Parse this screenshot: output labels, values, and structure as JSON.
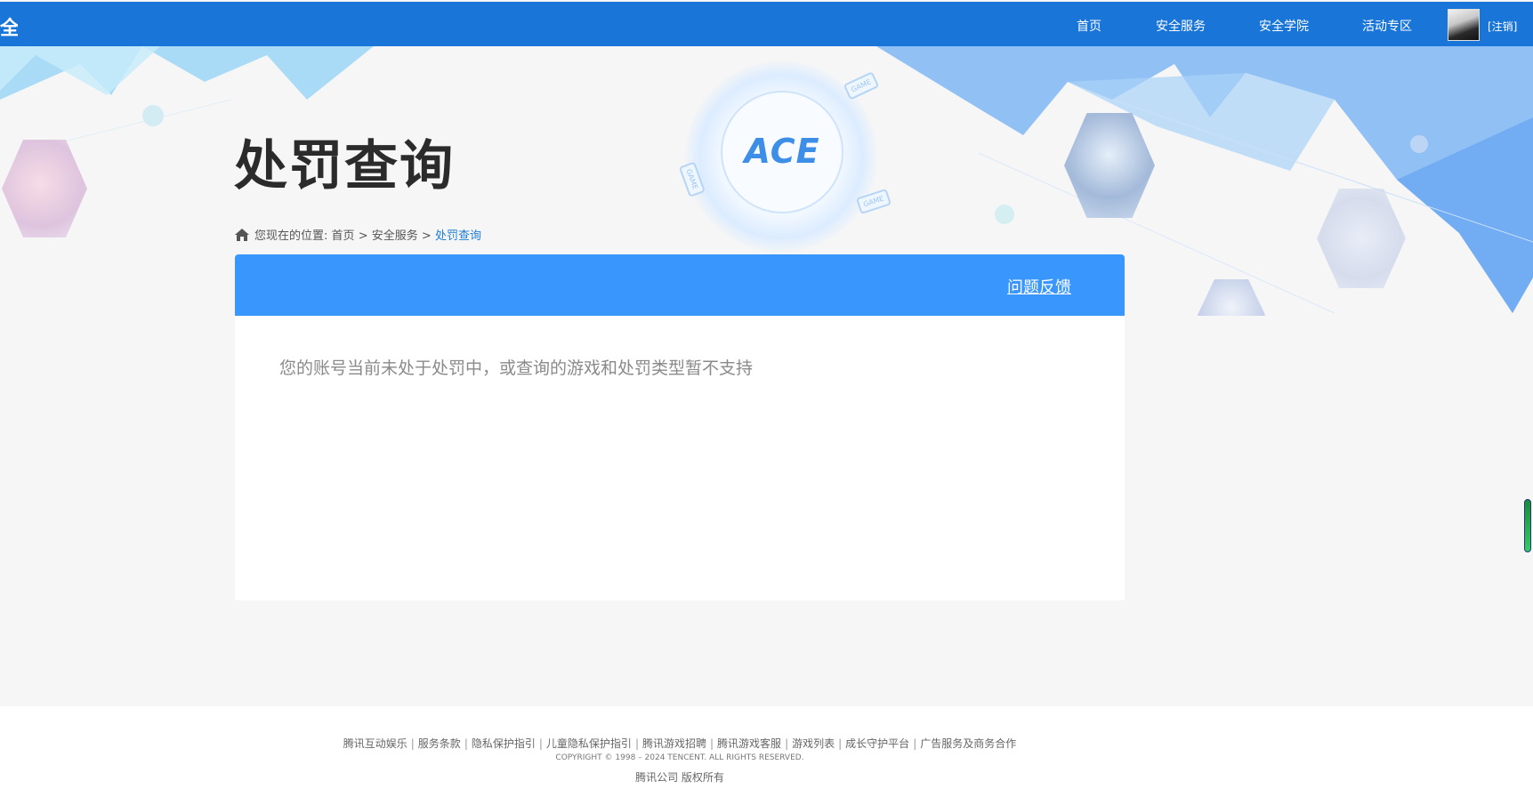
{
  "header": {
    "logo_fragment": "全",
    "nav": [
      {
        "label": "首页"
      },
      {
        "label": "安全服务"
      },
      {
        "label": "安全学院"
      },
      {
        "label": "活动专区"
      }
    ],
    "logout_label": "[注销]"
  },
  "hero": {
    "ace_logo_text": "ACE",
    "game_chip_label": "GAME"
  },
  "page": {
    "title": "处罚查询",
    "breadcrumb": {
      "prefix": "您现在的位置:",
      "items": [
        "首页",
        "安全服务"
      ],
      "current": "处罚查询",
      "separator": ">"
    }
  },
  "panel": {
    "feedback_label": "问题反馈",
    "message": "您的账号当前未处于处罚中，或查询的游戏和处罚类型暂不支持"
  },
  "footer": {
    "links": [
      "腾讯互动娱乐",
      "服务条款",
      "隐私保护指引",
      "儿童隐私保护指引",
      "腾讯游戏招聘",
      "腾讯游戏客服",
      "游戏列表",
      "成长守护平台",
      "广告服务及商务合作"
    ],
    "copyright": "COPYRIGHT © 1998 – 2024 TENCENT. ALL RIGHTS RESERVED.",
    "rights": "腾讯公司 版权所有"
  },
  "colors": {
    "topbar": "#1976d8",
    "panel_header": "#3896fd",
    "breadcrumb_current": "#1f7cd6"
  }
}
